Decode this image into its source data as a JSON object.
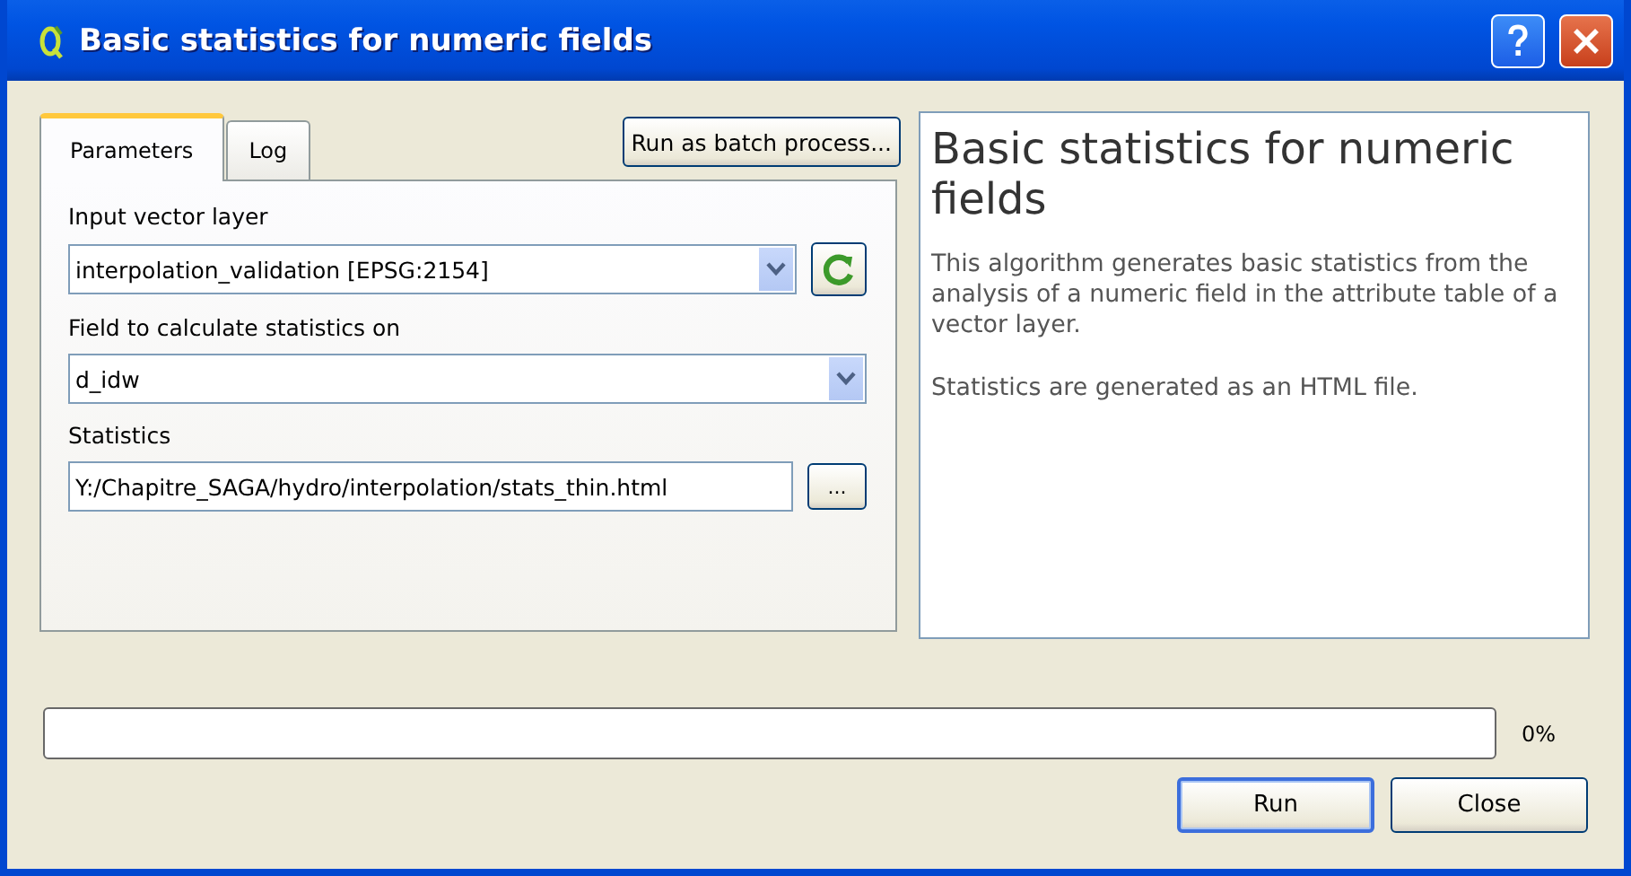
{
  "window": {
    "title": "Basic statistics for numeric fields"
  },
  "tabs": [
    {
      "label": "Parameters",
      "selected": true
    },
    {
      "label": "Log",
      "selected": false
    }
  ],
  "batch_button": "Run as batch process...",
  "parameters": [
    {
      "kind": "combo",
      "label": "Input vector layer",
      "value": "interpolation_validation [EPSG:2154]",
      "refresh": true
    },
    {
      "kind": "combo",
      "label": "Field to calculate statistics on",
      "value": "d_idw",
      "refresh": false
    },
    {
      "kind": "file",
      "label": "Statistics",
      "value": "Y:/Chapitre_SAGA/hydro/interpolation/stats_thin.html",
      "browse": "..."
    }
  ],
  "help": {
    "title": "Basic statistics for numeric fields",
    "paragraphs": [
      "This algorithm generates basic statistics from the analysis of a numeric field in the attribute table of a vector layer.",
      "Statistics are generated as an HTML file."
    ]
  },
  "progress": {
    "level": 0,
    "reading": "0%"
  },
  "buttons": [
    {
      "label": "Run",
      "default": true
    },
    {
      "label": "Close",
      "default": false
    }
  ]
}
